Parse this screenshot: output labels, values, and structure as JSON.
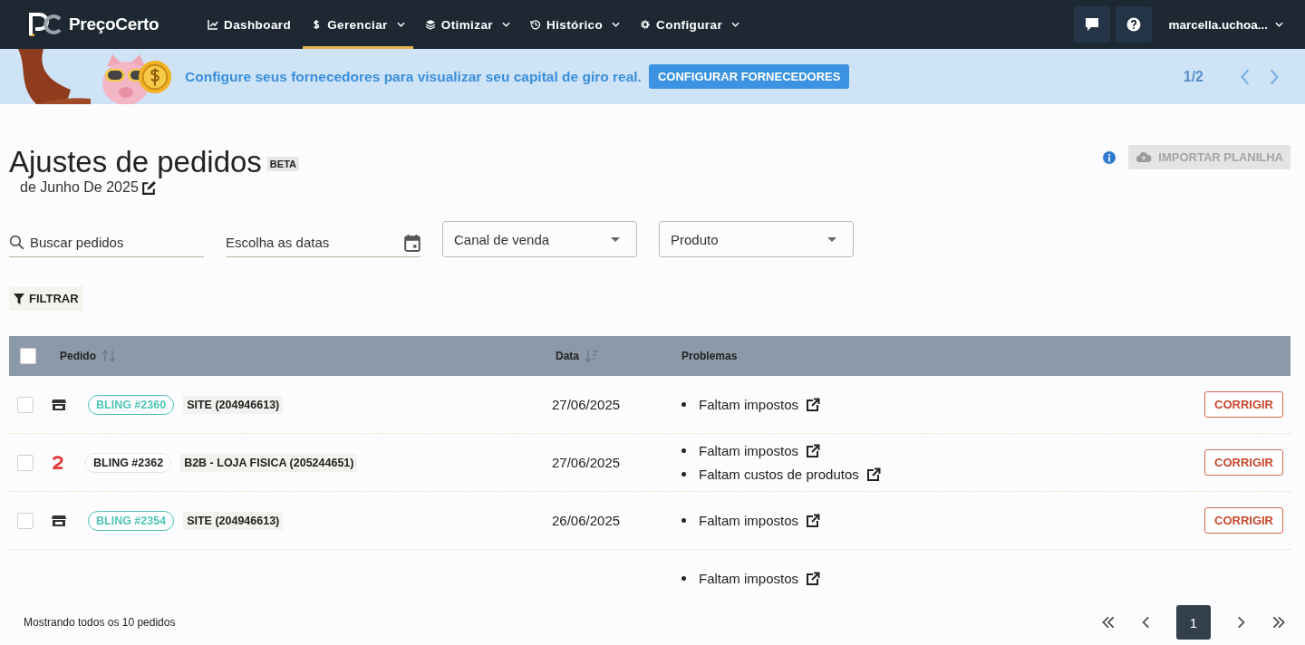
{
  "nav": {
    "brand": "PreçoCerto",
    "items": [
      {
        "label": "Dashboard",
        "kind": "chart",
        "dropdown": false,
        "selected": false
      },
      {
        "label": "Gerenciar",
        "kind": "dollar",
        "dropdown": true,
        "selected": true
      },
      {
        "label": "Otimizar",
        "kind": "layers",
        "dropdown": true,
        "selected": false
      },
      {
        "label": "Histórico",
        "kind": "history",
        "dropdown": true,
        "selected": false
      },
      {
        "label": "Configurar",
        "kind": "gear",
        "dropdown": true,
        "selected": false
      }
    ],
    "user": "marcella.uchoa..."
  },
  "banner": {
    "message": "Configure seus fornecedores para visualizar seu capital de giro real.",
    "button": "CONFIGURAR FORNECEDORES",
    "pager": "1/2"
  },
  "page": {
    "title": "Ajustes de pedidos",
    "badge": "BETA",
    "subtitle": "de Junho De 2025",
    "import_button": "IMPORTAR PLANILHA"
  },
  "filters": {
    "search": {
      "placeholder": "Buscar pedidos"
    },
    "dates": {
      "placeholder": "Escolha as datas"
    },
    "channel": {
      "placeholder": "Canal de venda"
    },
    "product": {
      "placeholder": "Produto"
    },
    "filter_button": "FILTRAR"
  },
  "table": {
    "columns": [
      "Pedido",
      "Data",
      "Problemas"
    ],
    "header_checked": false,
    "rows": [
      {
        "checked": false,
        "kind": "store",
        "order": "BLING #2360",
        "color": "#4fc3b7",
        "store": "SITE (204946613)",
        "date": "27/06/2025",
        "problems": [
          "Faltam impostos"
        ],
        "action": "CORRIGIR"
      },
      {
        "checked": false,
        "kind": "marketplace",
        "order": "BLING #2362",
        "color": "#222222",
        "store": "B2B - LOJA FISICA (205244651)",
        "date": "27/06/2025",
        "problems": [
          "Faltam impostos",
          "Faltam custos de produtos"
        ],
        "action": "CORRIGIR"
      },
      {
        "checked": false,
        "kind": "store",
        "order": "BLING #2354",
        "color": "#4fc3b7",
        "store": "SITE (204946613)",
        "date": "26/06/2025",
        "problems": [
          "Faltam impostos"
        ],
        "action": "CORRIGIR"
      },
      {
        "problems": [
          "Faltam impostos"
        ]
      }
    ]
  },
  "footer": {
    "summary": "Mostrando todos os 10 pedidos",
    "pages": [
      {
        "label": "1",
        "selected": true
      }
    ]
  }
}
